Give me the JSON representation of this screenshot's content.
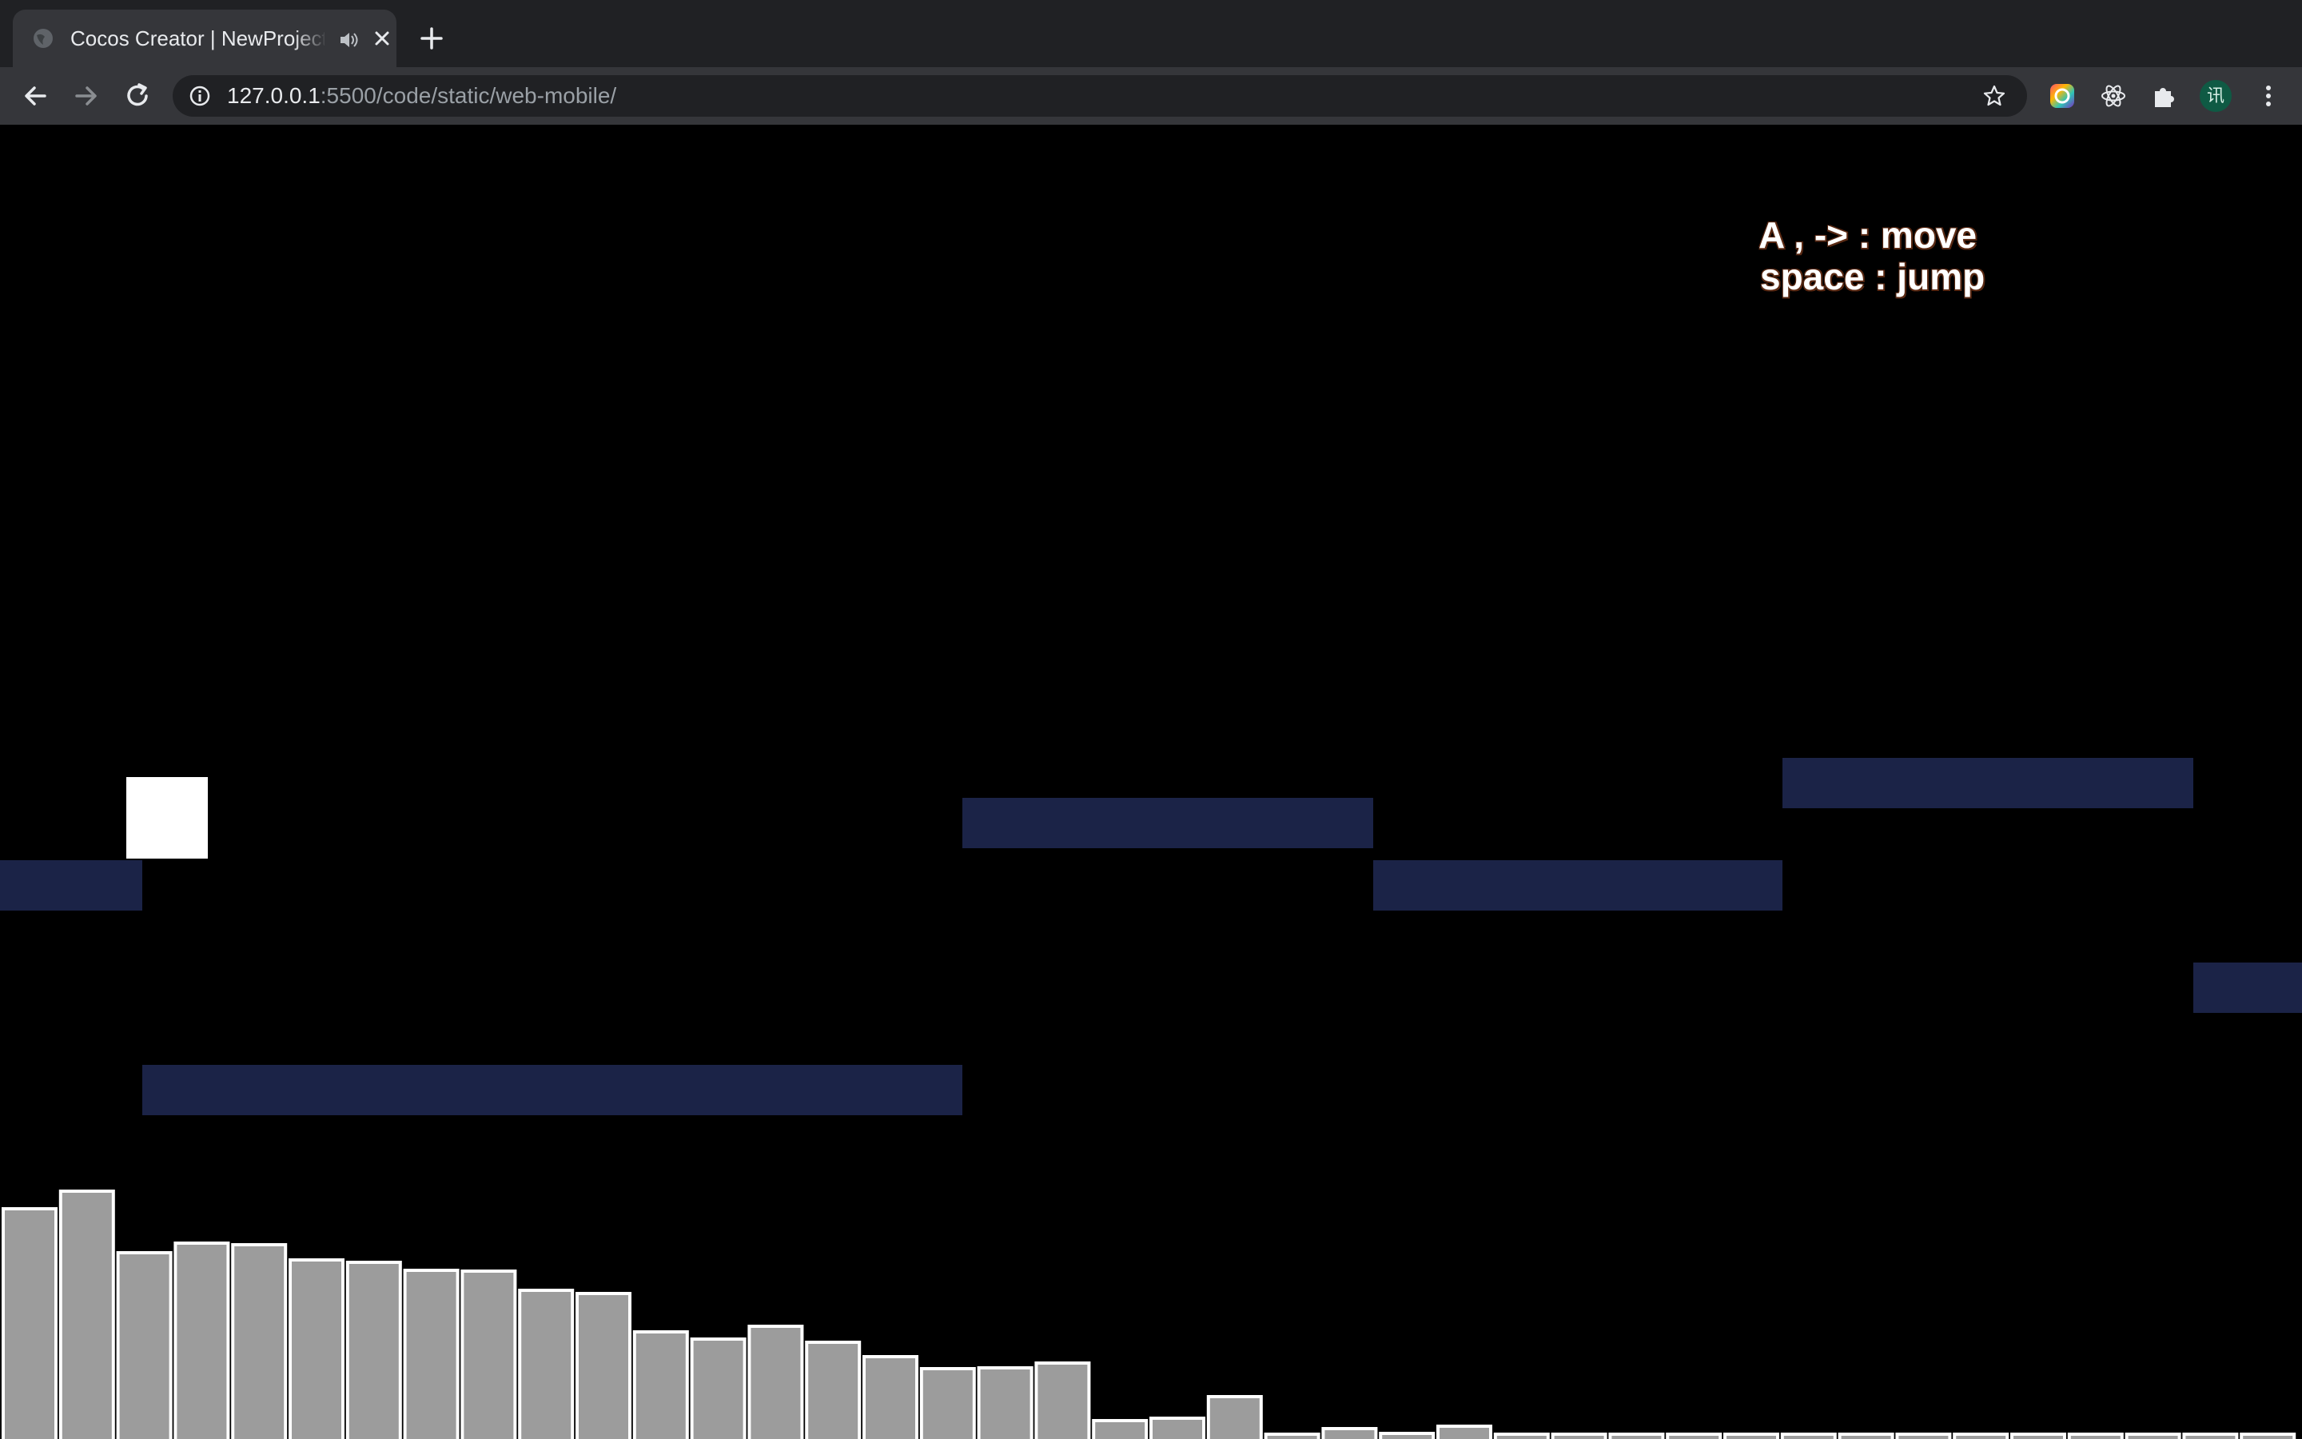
{
  "browser": {
    "tab": {
      "title": "Cocos Creator | NewProject"
    },
    "address": {
      "host": "127.0.0.1",
      "rest": ":5500/code/static/web-mobile/"
    },
    "profile_initial": "讯",
    "colors": {
      "frame": "#202124",
      "toolbar": "#35363a",
      "text": "#e8eaed"
    },
    "icons": [
      "globe-icon",
      "speaker-icon",
      "close-icon",
      "plus-icon",
      "back-arrow-icon",
      "forward-arrow-icon",
      "reload-icon",
      "info-icon",
      "star-icon",
      "color-circle-extension-icon",
      "react-extension-icon",
      "puzzle-extension-icon",
      "profile-avatar",
      "kebab-menu-icon"
    ]
  },
  "game": {
    "controls": {
      "line1": "A , -> : move",
      "line2": "space : jump"
    },
    "colors": {
      "background": "#000000",
      "platform": "#1b2347",
      "player": "#ffffff",
      "bar": "#9c9c9c",
      "bar_outline": "#ffffff"
    }
  },
  "chart_data": {
    "type": "bar",
    "values": [
      288,
      310,
      233,
      245,
      243,
      224,
      221,
      211,
      210,
      186,
      182,
      134,
      125,
      141,
      121,
      103,
      88,
      89,
      95,
      23,
      26,
      53,
      6,
      13,
      7,
      16,
      6,
      6,
      6,
      6,
      6,
      6,
      6,
      6,
      6,
      6,
      6,
      6,
      6,
      6
    ]
  }
}
